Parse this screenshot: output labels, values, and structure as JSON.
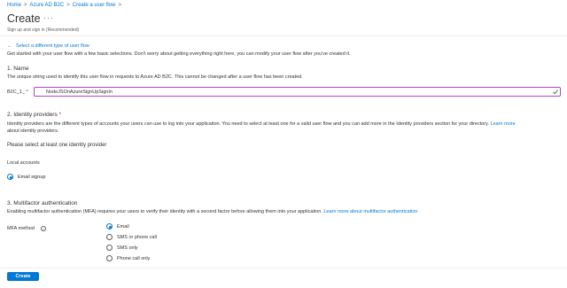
{
  "breadcrumb": {
    "items": [
      "Home",
      "Azure AD B2C",
      "Create a user flow"
    ],
    "separator": ">"
  },
  "header": {
    "title": "Create",
    "more": "···",
    "subtitle": "Sign up and sign in (Recommended)"
  },
  "back_link": "Select a different type of user flow",
  "intro": "Get started with your user flow with a few basic selections. Don't worry about getting everything right here, you can modify your user flow after you've created it.",
  "name_section": {
    "heading": "1. Name",
    "description": "The unique string used to identify this user flow in requests to Azure AD B2C. This cannot be changed after a user flow has been created.",
    "prefix_label": "B2C_1_",
    "required_mark": "*",
    "value": "NodeJSOnAzureSignUpSignIn"
  },
  "idp_section": {
    "heading": "2. Identity providers",
    "required_mark": "*",
    "description_line1": "Identity providers are the different types of accounts your users can use to log into your application. You need to select at least one for a valid user flow and you can add more in the Identity providers section for your directory.",
    "link_part1": "Learn more",
    "link_part2": "about identity providers.",
    "warning": "Please select at least one identity provider",
    "local_accounts_label": "Local accounts",
    "option": "Email signup"
  },
  "mfa_section": {
    "heading": "3. Multifactor authentication",
    "description": "Enabling multifactor authentication (MFA) requires your users to verify their identity with a second factor before allowing them into your application.",
    "link": "Learn more about multifactor authentication",
    "method_label": "MFA method",
    "info": "i",
    "options": [
      "Email",
      "SMS or phone call",
      "SMS only",
      "Phone call only"
    ],
    "selected": "Email"
  },
  "footer": {
    "create_label": "Create"
  },
  "colors": {
    "accent": "#0078d4",
    "input_border": "#b146c2",
    "required": "#a4262c"
  }
}
